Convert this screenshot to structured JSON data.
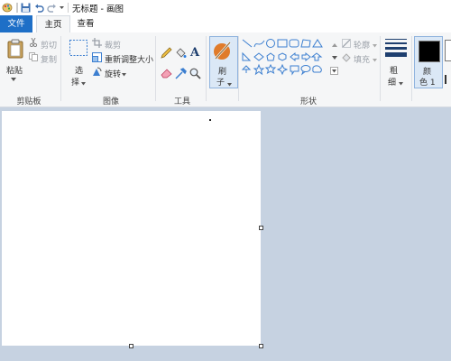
{
  "window": {
    "title": "无标题 - 画图"
  },
  "tabs": [
    {
      "label": "文件"
    },
    {
      "label": "主页"
    },
    {
      "label": "查看"
    }
  ],
  "clipboard": {
    "paste": "粘贴",
    "cut": "剪切",
    "copy": "复制",
    "group": "剪贴板"
  },
  "image": {
    "select_1": "选",
    "select_2": "择",
    "crop": "裁剪",
    "resize": "重新调整大小",
    "rotate": "旋转",
    "group": "图像"
  },
  "tools": {
    "group": "工具"
  },
  "brush": {
    "label_1": "刷",
    "label_2": "子"
  },
  "shapes": {
    "outline": "轮廓",
    "fill": "填充",
    "group": "形状"
  },
  "size": {
    "label_1": "粗",
    "label_2": "细"
  },
  "colors": {
    "color1_1": "颜",
    "color1_2": "色 1",
    "color1_value": "#000000",
    "accent": "#1e6fc7"
  }
}
